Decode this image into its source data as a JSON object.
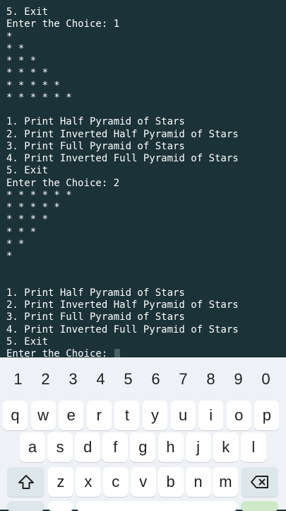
{
  "terminal": {
    "lines": [
      "5. Exit",
      "Enter the Choice: 1",
      "*",
      "* *",
      "* * *",
      "* * * *",
      "* * * * *",
      "* * * * * *",
      "",
      "1. Print Half Pyramid of Stars",
      "2. Print Inverted Half Pyramid of Stars",
      "3. Print Full Pyramid of Stars",
      "4. Print Inverted Full Pyramid of Stars",
      "5. Exit",
      "Enter the Choice: 2",
      "* * * * * *",
      "* * * * *",
      "* * * *",
      "* * *",
      "* *",
      "*",
      "",
      "",
      "1. Print Half Pyramid of Stars",
      "2. Print Inverted Half Pyramid of Stars",
      "3. Print Full Pyramid of Stars",
      "4. Print Inverted Full Pyramid of Stars",
      "5. Exit"
    ],
    "prompt": "Enter the Choice: "
  },
  "keyboard": {
    "number_row": [
      "1",
      "2",
      "3",
      "4",
      "5",
      "6",
      "7",
      "8",
      "9",
      "0"
    ],
    "row1": [
      "q",
      "w",
      "e",
      "r",
      "t",
      "y",
      "u",
      "i",
      "o",
      "p"
    ],
    "row2": [
      "a",
      "s",
      "d",
      "f",
      "g",
      "h",
      "j",
      "k",
      "l"
    ],
    "row3": [
      "z",
      "x",
      "c",
      "v",
      "b",
      "n",
      "m"
    ],
    "shift_icon": "shift-arrow-icon",
    "backspace_icon": "backspace-icon"
  },
  "colors": {
    "terminal_bg": "#1b3238",
    "terminal_text": "#ffffff",
    "keyboard_bg": "#eef2f6",
    "key_bg": "#ffffff",
    "special_key_bg": "#dde7e9"
  }
}
